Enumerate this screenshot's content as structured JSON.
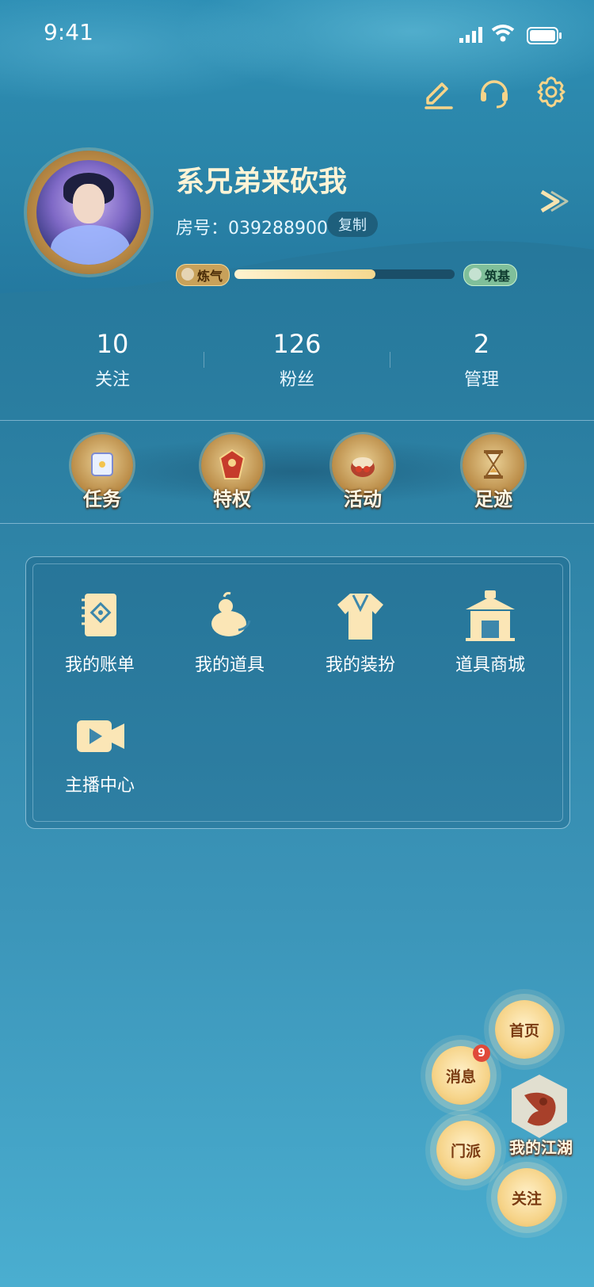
{
  "status_bar": {
    "time": "9:41"
  },
  "profile": {
    "username": "系兄弟来砍我",
    "room_label": "房号：",
    "room_number": "039288900",
    "copy_label": "复制",
    "level_current": "炼气",
    "level_next": "筑基",
    "level_progress": 0.64
  },
  "stats": [
    {
      "value": "10",
      "label": "关注"
    },
    {
      "value": "126",
      "label": "粉丝"
    },
    {
      "value": "2",
      "label": "管理"
    }
  ],
  "features": [
    {
      "label": "任务",
      "icon": "scroll-icon"
    },
    {
      "label": "特权",
      "icon": "privilege-icon"
    },
    {
      "label": "活动",
      "icon": "drum-icon"
    },
    {
      "label": "足迹",
      "icon": "hourglass-icon"
    }
  ],
  "menu": [
    {
      "label": "我的账单",
      "icon": "ledger-icon"
    },
    {
      "label": "我的道具",
      "icon": "gourd-icon"
    },
    {
      "label": "我的装扮",
      "icon": "robe-icon"
    },
    {
      "label": "道具商城",
      "icon": "shop-icon"
    },
    {
      "label": "主播中心",
      "icon": "video-icon"
    }
  ],
  "fab_menu": {
    "home": "首页",
    "messages": "消息",
    "messages_badge": "9",
    "sect": "门派",
    "follow": "关注",
    "my_jianghu": "我的江湖"
  },
  "colors": {
    "gold": "#f6d48a",
    "cream": "#fff4d6",
    "panel_border": "#d2f0ff",
    "badge_red": "#e04a3a"
  }
}
